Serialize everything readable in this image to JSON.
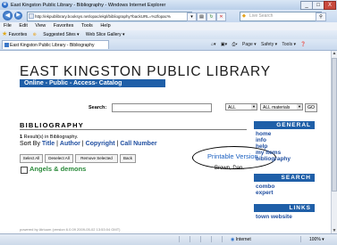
{
  "window": {
    "title": "East Kingston Public Library - Bibliography - Windows Internet Explorer",
    "minimize": "_",
    "maximize": "□",
    "close": "X"
  },
  "addressbar": {
    "url": "http://ekpublibrary.booksys.net/opac/ekpl/bibliography?backURL=%2fopac%",
    "search_placeholder": "Live Search"
  },
  "menu": [
    "File",
    "Edit",
    "View",
    "Favorites",
    "Tools",
    "Help"
  ],
  "favorites": {
    "label": "Favorites",
    "items": [
      "Suggested Sites ▾",
      "Web Slice Gallery ▾"
    ]
  },
  "tab": {
    "label": "East Kingston Public Library - Bibliography"
  },
  "commandbar": [
    "Page ▾",
    "Safety ▾",
    "Tools ▾"
  ],
  "page": {
    "library_title": "EAST KINGSTON PUBLIC LIBRARY",
    "catalog_bar": "Online - Public - Access- Catalog",
    "search_label": "Search:",
    "scope_select": "ALL",
    "materials_select": "ALL materials",
    "go_button": "GO",
    "section_heading": "BIBLIOGRAPHY",
    "result_count_num": "1",
    "result_count_text": "Result(s) in Bibliography.",
    "sort_by_label": "Sort By",
    "sort_options": [
      "Title",
      "Author",
      "Copyright",
      "Call Number"
    ],
    "buttons": [
      "Select All",
      "Deselect All",
      "Remove Selected",
      "Back"
    ],
    "results": [
      {
        "title": "Angels & demons",
        "author": "Brown, Dan."
      }
    ],
    "printable_version": "Printable Version",
    "powered_by": "powered by Atriuum (version 6.0.09 2009-05-02 13:53:04 GMT)"
  },
  "sidebar": {
    "general_heading": "GENERAL",
    "general_links": [
      "home",
      "info",
      "help",
      "my items",
      "bibliography"
    ],
    "search_heading": "SEARCH",
    "search_links": [
      "combo",
      "expert"
    ],
    "links_heading": "LINKS",
    "links_links": [
      "town website"
    ]
  },
  "statusbar": {
    "zone": "Internet",
    "zoom": "100%"
  }
}
